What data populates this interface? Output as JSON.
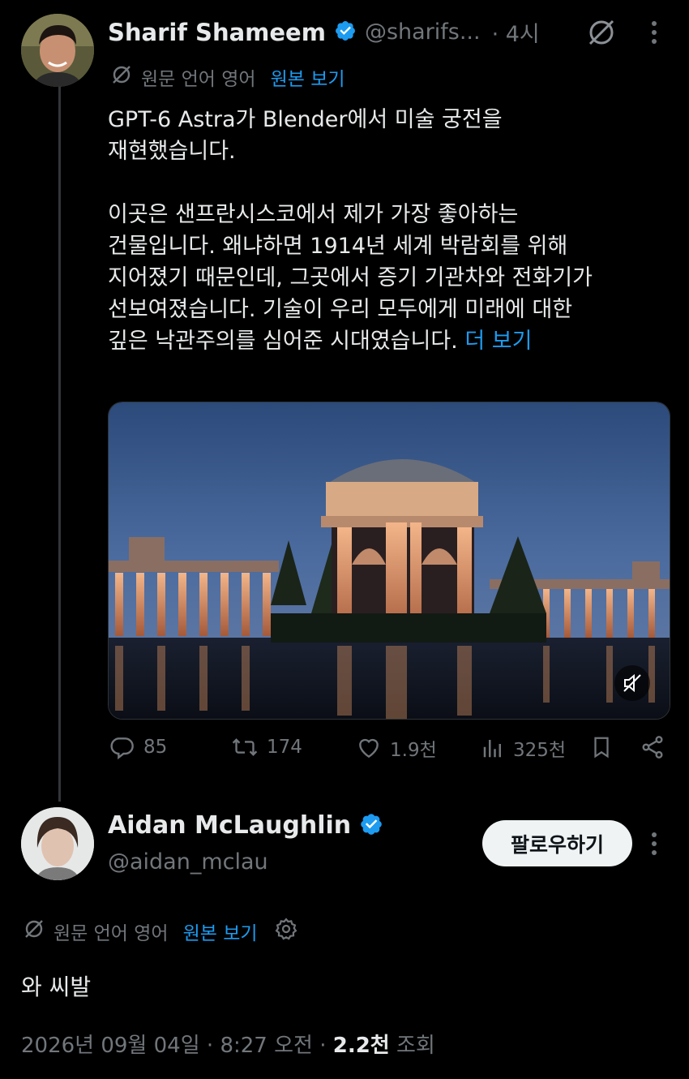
{
  "tweet": {
    "author_name": "Sharif Shameem",
    "author_handle": "@sharifs...",
    "time_ago": "· 4시",
    "translate_label": "원문 언어 영어",
    "translate_link": "원본 보기",
    "text_lines_1": [
      "GPT-6 Astra가 Blender에서 미술 궁전을",
      "재현했습니다."
    ],
    "text_lines_2": [
      "이곳은 샌프란시스코에서 제가 가장 좋아하는",
      "건물입니다. 왜냐하면 1914년 세계 박람회를 위해",
      "지어졌기 때문인데, 그곳에서 증기 기관차와 전화기가",
      "선보여졌습니다. 기술이 우리 모두에게 미래에 대한"
    ],
    "last_line": "깊은 낙관주의를 심어준 시대였습니다.",
    "more_link": "더 보기",
    "replies": "85",
    "reposts": "174",
    "likes": "1.9천",
    "views": "325천"
  },
  "reply": {
    "author_name": "Aidan McLaughlin",
    "author_handle": "@aidan_mclau",
    "follow_label": "팔로우하기",
    "translate_label": "원문 언어 영어",
    "translate_link": "원본 보기",
    "text": "와 씨발",
    "date": "2026년 09월 04일",
    "sep1": "·",
    "time": "8:27 오전",
    "sep2": "·",
    "views_count": "2.2천",
    "views_label": "조회"
  },
  "colors": {
    "background": "#000000",
    "text": "#e7e9ea",
    "muted": "#71767b",
    "link": "#1d9bf0",
    "verified": "#1d9bf0"
  },
  "icons": [
    "verified-badge-icon",
    "grok-icon",
    "more-icon",
    "no-translate-icon",
    "reply-icon",
    "repost-icon",
    "like-icon",
    "views-icon",
    "bookmark-icon",
    "share-icon",
    "mute-icon",
    "settings-icon"
  ]
}
